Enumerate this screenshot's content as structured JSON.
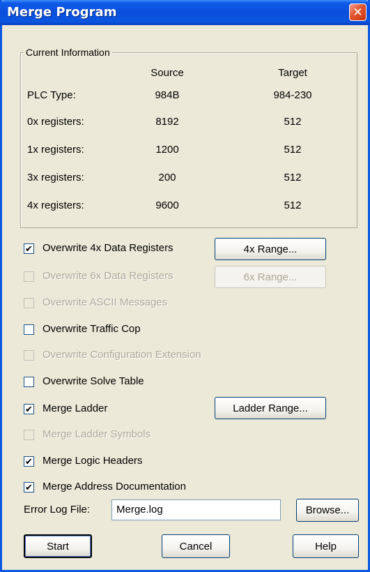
{
  "window": {
    "title": "Merge Program",
    "close_glyph": "✕"
  },
  "info": {
    "legend": "Current Information",
    "col_source": "Source",
    "col_target": "Target",
    "rows": [
      {
        "label": "PLC Type:",
        "source": "984B",
        "target": "984-230"
      },
      {
        "label": "0x registers:",
        "source": "8192",
        "target": "512"
      },
      {
        "label": "1x registers:",
        "source": "1200",
        "target": "512"
      },
      {
        "label": "3x registers:",
        "source": "200",
        "target": "512"
      },
      {
        "label": "4x registers:",
        "source": "9600",
        "target": "512"
      }
    ]
  },
  "options": [
    {
      "label": "Overwrite 4x Data Registers",
      "checked": true,
      "enabled": true
    },
    {
      "label": "Overwrite 6x Data Registers",
      "checked": false,
      "enabled": false
    },
    {
      "label": "Overwrite ASCII Messages",
      "checked": false,
      "enabled": false
    },
    {
      "label": "Overwrite Traffic Cop",
      "checked": false,
      "enabled": true
    },
    {
      "label": "Overwrite Configuration Extension",
      "checked": false,
      "enabled": false
    },
    {
      "label": "Overwrite Solve Table",
      "checked": false,
      "enabled": true
    },
    {
      "label": "Merge Ladder",
      "checked": true,
      "enabled": true
    },
    {
      "label": "Merge Ladder Symbols",
      "checked": false,
      "enabled": false
    },
    {
      "label": "Merge Logic Headers",
      "checked": true,
      "enabled": true
    },
    {
      "label": "Merge Address Documentation",
      "checked": true,
      "enabled": true
    }
  ],
  "check_glyph": "✔",
  "range_buttons": {
    "range_4x": "4x Range...",
    "range_6x": "6x Range...",
    "ladder_range": "Ladder Range..."
  },
  "error_log": {
    "label": "Error Log File:",
    "value": "Merge.log",
    "browse": "Browse..."
  },
  "actions": {
    "start": "Start",
    "cancel": "Cancel",
    "help": "Help"
  }
}
